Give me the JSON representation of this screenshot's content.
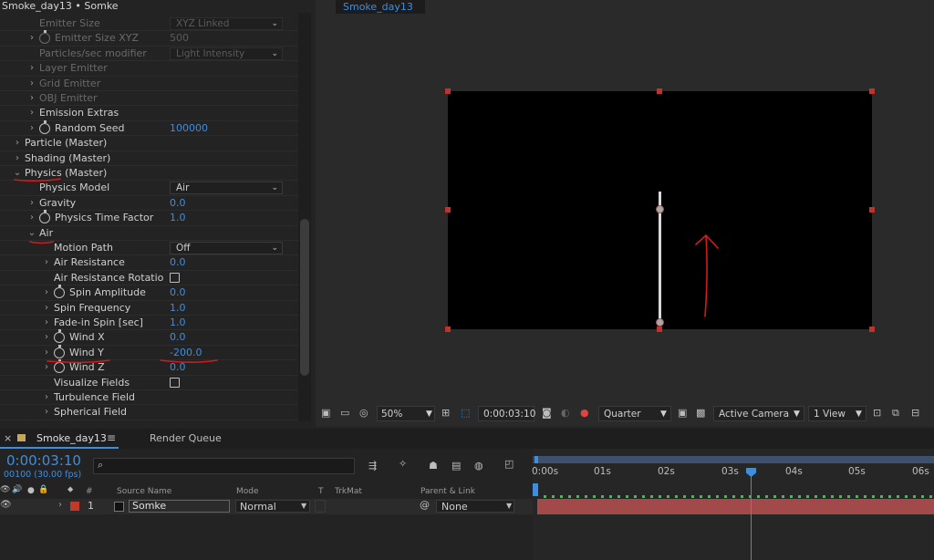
{
  "app": {
    "panel_title": "Smoke_day13 • Somke",
    "viewer_tab": "Smoke_day13"
  },
  "properties": [
    {
      "label": "Emitter Size",
      "value": "XYZ Linked",
      "type": "dropdown",
      "indent": 3,
      "dim": true,
      "twirl": false,
      "stopwatch": false
    },
    {
      "label": "Emitter Size XYZ",
      "value": "500",
      "type": "number",
      "indent": 3,
      "dim": true,
      "twirl": true,
      "stopwatch": true
    },
    {
      "label": "Particles/sec modifier",
      "value": "Light Intensity",
      "type": "dropdown",
      "indent": 3,
      "dim": true,
      "twirl": false,
      "stopwatch": false
    },
    {
      "label": "Layer Emitter",
      "value": "",
      "type": "group",
      "indent": 3,
      "dim": true,
      "twirl": true,
      "stopwatch": false
    },
    {
      "label": "Grid Emitter",
      "value": "",
      "type": "group",
      "indent": 3,
      "dim": true,
      "twirl": true,
      "stopwatch": false
    },
    {
      "label": "OBJ Emitter",
      "value": "",
      "type": "group",
      "indent": 3,
      "dim": true,
      "twirl": true,
      "stopwatch": false
    },
    {
      "label": "Emission Extras",
      "value": "",
      "type": "group",
      "indent": 3,
      "dim": false,
      "twirl": true,
      "stopwatch": false
    },
    {
      "label": "Random Seed",
      "value": "100000",
      "type": "number",
      "indent": 3,
      "dim": false,
      "twirl": true,
      "stopwatch": true
    },
    {
      "label": "Particle (Master)",
      "value": "",
      "type": "group",
      "indent": 2,
      "dim": false,
      "twirl": true,
      "stopwatch": false
    },
    {
      "label": "Shading (Master)",
      "value": "",
      "type": "group",
      "indent": 2,
      "dim": false,
      "twirl": true,
      "stopwatch": false
    },
    {
      "label": "Physics (Master)",
      "value": "",
      "type": "group",
      "indent": 2,
      "dim": false,
      "twirl": true,
      "open": true,
      "stopwatch": false
    },
    {
      "label": "Physics Model",
      "value": "Air",
      "type": "dropdown",
      "indent": 3,
      "dim": false,
      "twirl": false,
      "stopwatch": false
    },
    {
      "label": "Gravity",
      "value": "0.0",
      "type": "number",
      "indent": 3,
      "dim": false,
      "twirl": true,
      "stopwatch": false
    },
    {
      "label": "Physics Time Factor",
      "value": "1.0",
      "type": "number",
      "indent": 3,
      "dim": false,
      "twirl": true,
      "stopwatch": true
    },
    {
      "label": "Air",
      "value": "",
      "type": "group",
      "indent": 3,
      "dim": false,
      "twirl": true,
      "open": true,
      "stopwatch": false
    },
    {
      "label": "Motion Path",
      "value": "Off",
      "type": "dropdown",
      "indent": 4,
      "dim": false,
      "twirl": false,
      "stopwatch": false
    },
    {
      "label": "Air Resistance",
      "value": "0.0",
      "type": "number",
      "indent": 4,
      "dim": false,
      "twirl": true,
      "stopwatch": false
    },
    {
      "label": "Air Resistance Rotatio",
      "value": "",
      "type": "checkbox",
      "indent": 4,
      "dim": false,
      "twirl": false,
      "stopwatch": false
    },
    {
      "label": "Spin Amplitude",
      "value": "0.0",
      "type": "number",
      "indent": 4,
      "dim": false,
      "twirl": true,
      "stopwatch": true
    },
    {
      "label": "Spin Frequency",
      "value": "1.0",
      "type": "number",
      "indent": 4,
      "dim": false,
      "twirl": true,
      "stopwatch": false
    },
    {
      "label": "Fade-in Spin [sec]",
      "value": "1.0",
      "type": "number",
      "indent": 4,
      "dim": false,
      "twirl": true,
      "stopwatch": false
    },
    {
      "label": "Wind X",
      "value": "0.0",
      "type": "number",
      "indent": 4,
      "dim": false,
      "twirl": true,
      "stopwatch": true
    },
    {
      "label": "Wind Y",
      "value": "-200.0",
      "type": "number",
      "indent": 4,
      "dim": false,
      "twirl": true,
      "stopwatch": true
    },
    {
      "label": "Wind Z",
      "value": "0.0",
      "type": "number",
      "indent": 4,
      "dim": false,
      "twirl": true,
      "stopwatch": true
    },
    {
      "label": "Visualize Fields",
      "value": "",
      "type": "checkbox",
      "indent": 4,
      "dim": false,
      "twirl": false,
      "stopwatch": false
    },
    {
      "label": "Turbulence Field",
      "value": "",
      "type": "group",
      "indent": 4,
      "dim": false,
      "twirl": true,
      "stopwatch": false
    },
    {
      "label": "Spherical Field",
      "value": "",
      "type": "group",
      "indent": 4,
      "dim": false,
      "twirl": true,
      "stopwatch": false
    }
  ],
  "viewer_bar": {
    "zoom": "50%",
    "timecode": "0:00:03:10",
    "resolution": "Quarter",
    "camera": "Active Camera",
    "views": "1 View"
  },
  "timeline": {
    "comp_tab": "Smoke_day13",
    "render_queue": "Render Queue",
    "timecode": "0:00:03:10",
    "frame_info": "00100 (30.00 fps)",
    "search_placeholder": "",
    "column_headers": {
      "number": "#",
      "source_name": "Source Name",
      "mode": "Mode",
      "t": "T",
      "trkmat": "TrkMat",
      "parent": "Parent & Link"
    },
    "layer": {
      "number": "1",
      "name": "Somke",
      "mode": "Normal",
      "parent": "None"
    },
    "ruler_labels": [
      "0:00s",
      "01s",
      "02s",
      "03s",
      "04s",
      "05s",
      "06s"
    ]
  },
  "colors": {
    "accent_blue": "#3d8ee0",
    "layer_bar": "#a24a4a",
    "handle_red": "#c0322e",
    "annotation_red": "#d01c1c"
  }
}
